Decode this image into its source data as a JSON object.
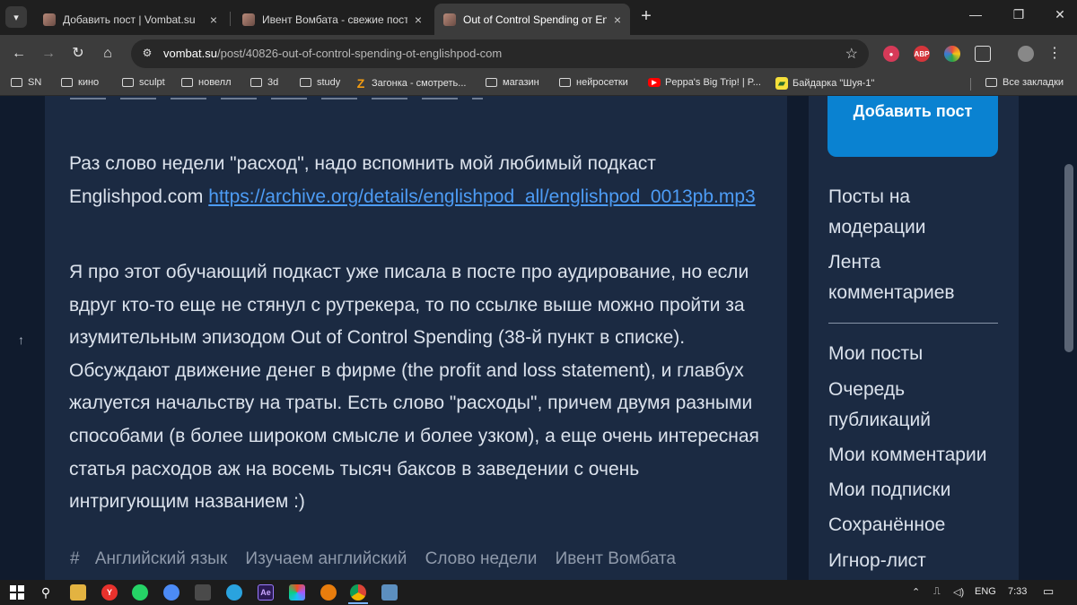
{
  "browser": {
    "menu_icon": "chevron-down-icon",
    "tabs": [
      {
        "title": "Добавить пост | Vombat.su",
        "active": false
      },
      {
        "title": "Ивент Вомбата - свежие посты",
        "active": false
      },
      {
        "title": "Out of Control Spending от Englishpod.com",
        "active": true
      }
    ],
    "new_tab_glyph": "+",
    "close_glyph": "×",
    "window_controls": {
      "minimize": "—",
      "restore": "❐",
      "close": "✕"
    },
    "nav": {
      "back": "←",
      "forward": "→",
      "reload": "↻",
      "home": "⌂"
    },
    "url_host": "vombat.su",
    "url_path": "/post/40826-out-of-control-spending-ot-englishpod-com",
    "bookmarks": [
      {
        "label": "SN",
        "type": "folder"
      },
      {
        "label": "кино",
        "type": "folder"
      },
      {
        "label": "sculpt",
        "type": "folder"
      },
      {
        "label": "новелл",
        "type": "folder"
      },
      {
        "label": "3d",
        "type": "folder"
      },
      {
        "label": "study",
        "type": "folder"
      },
      {
        "label": "Загонка - смотреть...",
        "type": "site"
      },
      {
        "label": "магазин",
        "type": "folder"
      },
      {
        "label": "нейросетки",
        "type": "folder"
      },
      {
        "label": "Peppa's Big Trip! | P...",
        "type": "site"
      },
      {
        "label": "Байдарка \"Шуя-1\"",
        "type": "site"
      }
    ],
    "all_bookmarks": "Все закладки",
    "extensions": [
      {
        "name": "record-extension-icon",
        "label": "",
        "color": "#d63a58"
      },
      {
        "name": "adblock-extension-icon",
        "label": "ABP",
        "color": "#d5353b"
      },
      {
        "name": "colorful-extension-icon",
        "label": "",
        "color": "#2aa34a"
      },
      {
        "name": "puzzle-extensions-icon",
        "label": "",
        "color": "#3c3c3c"
      }
    ]
  },
  "article": {
    "paragraph1_text": "Раз слово недели \"расход\", надо вспомнить мой любимый подкаст Englishpod.com ",
    "paragraph1_link": "https://archive.org/details/englishpod_all/englishpod_0013pb.mp3",
    "paragraph2": "Я про этот обучающий подкаст уже писала в посте про аудирование, но если вдруг кто-то еще не стянул с рутрекера, то по ссылке выше можно пройти за изумительным эпизодом Out of Control Spending (38-й пункт в списке).  Обсуждают движение денег в фирме (the profit and loss statement), и главбух жалуется начальству на траты.  Есть слово \"расходы\", причем двумя разными способами (в более широком смысле и более узком), а еще очень интересная статья расходов аж на восемь тысяч баксов в заведении с очень интригующим  названием :)",
    "tag_hash": "#",
    "tags": [
      "Английский язык",
      "Изучаем английский",
      "Слово недели",
      "Ивент Вомбата"
    ]
  },
  "sidebar": {
    "add_post_button": "Добавить пост",
    "group1": [
      "Посты на модерации",
      "Лента комментариев"
    ],
    "group2": [
      "Мои посты",
      "Очередь публикаций",
      "Мои комментарии",
      "Мои подписки",
      "Сохранённое",
      "Игнор-лист"
    ]
  },
  "page": {
    "scroll_up_glyph": "↑"
  },
  "taskbar": {
    "apps": [
      {
        "name": "windows-start-icon",
        "label": "",
        "color": "#1c1c1c"
      },
      {
        "name": "search-icon",
        "label": "",
        "color": "#1c1c1c"
      },
      {
        "name": "file-explorer-icon",
        "label": "",
        "color": "#e3b341"
      },
      {
        "name": "yandex-browser-icon",
        "label": "Y",
        "color": "#e8322d"
      },
      {
        "name": "whatsapp-icon",
        "label": "",
        "color": "#25d366"
      },
      {
        "name": "chromium-icon",
        "label": "",
        "color": "#4c8bf5"
      },
      {
        "name": "calculator-icon",
        "label": "",
        "color": "#4a4a4a"
      },
      {
        "name": "telegram-icon",
        "label": "",
        "color": "#2aa3de"
      },
      {
        "name": "after-effects-icon",
        "label": "Ae",
        "color": "#2b1a55"
      },
      {
        "name": "figma-icon",
        "label": "",
        "color": "#2c2c2c"
      },
      {
        "name": "blender-icon",
        "label": "",
        "color": "#e87d0d"
      },
      {
        "name": "chrome-icon",
        "label": "",
        "color": "#ffffff"
      },
      {
        "name": "image-viewer-icon",
        "label": "",
        "color": "#5c8fbf"
      }
    ],
    "language": "ENG",
    "time": "7:33"
  },
  "colors": {
    "page_bg": "#101b2d",
    "card_bg": "#1b2a42",
    "text": "#dbe2ec",
    "link": "#4d9cf5",
    "accent_button": "#0a82d1",
    "tags": "#8f9aab"
  }
}
